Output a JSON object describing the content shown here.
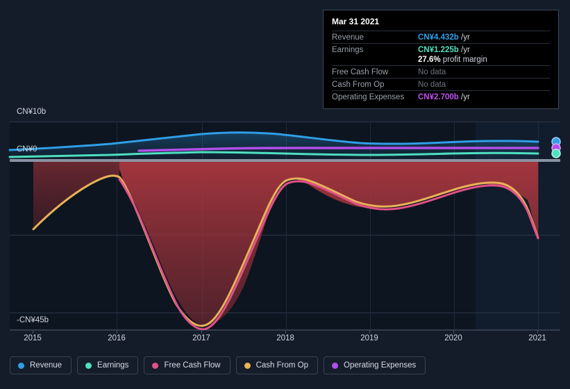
{
  "tooltip": {
    "date": "Mar 31 2021",
    "rows": [
      {
        "label": "Revenue",
        "amount": "CN¥4.432b",
        "unit": "/yr",
        "color": "#2f9fe8",
        "nodata": false
      },
      {
        "label": "Earnings",
        "amount": "CN¥1.225b",
        "unit": "/yr",
        "color": "#4fe0c0",
        "nodata": false
      },
      {
        "label": "",
        "amount": "27.6%",
        "unit": "profit margin",
        "color": "#ffffff",
        "nodata": false,
        "sub": true
      },
      {
        "label": "Free Cash Flow",
        "amount": "No data",
        "unit": "",
        "color": "#6d747e",
        "nodata": true
      },
      {
        "label": "Cash From Op",
        "amount": "No data",
        "unit": "",
        "color": "#6d747e",
        "nodata": true
      },
      {
        "label": "Operating Expenses",
        "amount": "CN¥2.700b",
        "unit": "/yr",
        "color": "#c050f0",
        "nodata": false
      }
    ]
  },
  "legend": {
    "items": [
      {
        "label": "Revenue",
        "color": "#2f9fe8"
      },
      {
        "label": "Earnings",
        "color": "#4fe0c0"
      },
      {
        "label": "Free Cash Flow",
        "color": "#e0518a"
      },
      {
        "label": "Cash From Op",
        "color": "#e8b257"
      },
      {
        "label": "Operating Expenses",
        "color": "#b14fe8"
      }
    ]
  },
  "chart_data": {
    "type": "line",
    "title": "",
    "xlabel": "",
    "ylabel": "",
    "currency": "CN¥",
    "unit": "b",
    "x": [
      2015,
      2016,
      2017,
      2018,
      2019,
      2020,
      2021
    ],
    "xlim": [
      2015,
      2021
    ],
    "ylim": [
      -45,
      10
    ],
    "grid": true,
    "y_ticks": [
      {
        "value": 10,
        "label": "CN¥10b"
      },
      {
        "value": 0,
        "label": "CN¥0"
      },
      {
        "value": -15,
        "label": ""
      },
      {
        "value": -30,
        "label": ""
      },
      {
        "value": -45,
        "label": "-CN¥45b"
      }
    ],
    "x_ticks": [
      {
        "value": 2015,
        "label": "2015"
      },
      {
        "value": 2016,
        "label": "2016"
      },
      {
        "value": 2017,
        "label": "2017"
      },
      {
        "value": 2018,
        "label": "2018"
      },
      {
        "value": 2019,
        "label": "2019"
      },
      {
        "value": 2020,
        "label": "2020"
      },
      {
        "value": 2021,
        "label": "2021"
      }
    ],
    "legend_position": "bottom",
    "series": [
      {
        "name": "Revenue",
        "color": "#2f9fe8",
        "x": [
          2015.0,
          2015.5,
          2016.0,
          2016.5,
          2017.0,
          2017.5,
          2018.0,
          2018.5,
          2019.0,
          2019.5,
          2020.0,
          2020.5,
          2021.0
        ],
        "values": [
          1.4,
          1.6,
          1.9,
          2.5,
          3.3,
          3.9,
          4.0,
          3.8,
          3.7,
          3.8,
          3.9,
          4.2,
          4.432
        ]
      },
      {
        "name": "Earnings",
        "color": "#4fe0c0",
        "x": [
          2015.0,
          2015.5,
          2016.0,
          2016.5,
          2017.0,
          2017.5,
          2018.0,
          2018.5,
          2019.0,
          2019.5,
          2020.0,
          2020.5,
          2021.0
        ],
        "values": [
          0.3,
          0.35,
          0.4,
          0.5,
          0.7,
          0.85,
          0.9,
          0.85,
          0.8,
          0.85,
          0.95,
          1.1,
          1.225
        ]
      },
      {
        "name": "Operating Expenses",
        "color": "#b14fe8",
        "x": [
          2016.55,
          2017.0,
          2017.5,
          2018.0,
          2018.5,
          2019.0,
          2019.5,
          2020.0,
          2020.5,
          2021.0
        ],
        "values": [
          1.55,
          1.7,
          1.9,
          2.0,
          2.0,
          2.05,
          2.1,
          2.25,
          2.5,
          2.7
        ]
      },
      {
        "name": "Cash From Op",
        "color": "#e8b257",
        "x": [
          2015.0,
          2015.3,
          2015.6,
          2016.0,
          2016.25,
          2016.6,
          2017.0,
          2017.3,
          2017.6,
          2018.0,
          2018.3,
          2018.7,
          2019.0,
          2019.5,
          2020.0,
          2020.5,
          2020.75,
          2021.0
        ],
        "values": [
          -19.0,
          -14.5,
          -10.5,
          -6.0,
          -5.5,
          -20.0,
          -42.8,
          -33.0,
          -17.0,
          -5.0,
          -4.5,
          -8.0,
          -10.5,
          -9.5,
          -7.5,
          -6.0,
          -6.5,
          -22.5
        ]
      },
      {
        "name": "Free Cash Flow",
        "color": "#e0518a",
        "x": [
          2016.25,
          2016.6,
          2017.0,
          2017.3,
          2017.6,
          2018.0,
          2018.3,
          2018.7,
          2019.0,
          2019.5,
          2020.0,
          2020.5,
          2020.75,
          2021.0
        ],
        "values": [
          -5.6,
          -21.0,
          -43.5,
          -33.5,
          -17.5,
          -5.8,
          -5.2,
          -8.5,
          -11.0,
          -10.0,
          -8.0,
          -6.4,
          -6.9,
          -22.8
        ]
      }
    ],
    "annotations": {
      "shaded_region_label": "negative cash flow area",
      "shaded_region_color": "#a3333a",
      "highlight_panel_from": 2020.35
    }
  }
}
